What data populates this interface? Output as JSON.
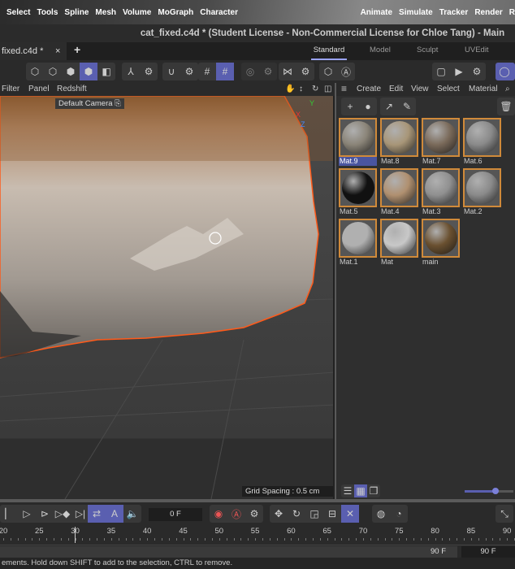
{
  "menubar": {
    "items": [
      "Select",
      "Tools",
      "Spline",
      "Mesh",
      "Volume",
      "MoGraph",
      "Character"
    ],
    "right_items": [
      "Animate",
      "Simulate",
      "Tracker",
      "Render",
      "R"
    ]
  },
  "window_title": "cat_fixed.c4d * (Student License - Non-Commercial License for Chloe Tang) - Main",
  "document_tab": {
    "label": "fixed.c4d *",
    "close": "×",
    "add": "+"
  },
  "layouts": [
    {
      "label": "Standard",
      "active": true
    },
    {
      "label": "Model"
    },
    {
      "label": "Sculpt"
    },
    {
      "label": "UVEdit"
    }
  ],
  "viewport": {
    "menu": [
      "Filter",
      "Panel",
      "Redshift"
    ],
    "camera": "Default Camera",
    "grid_spacing": "Grid Spacing : 0.5 cm",
    "axis": {
      "y": "Y",
      "x": "X",
      "z": "Z"
    }
  },
  "material_manager": {
    "menu": [
      "Create",
      "Edit",
      "View",
      "Select",
      "Material"
    ],
    "materials": [
      {
        "name": "Mat.9",
        "selected": true,
        "color": "#8a8478"
      },
      {
        "name": "Mat.8",
        "color": "#a89678"
      },
      {
        "name": "Mat.7",
        "color": "#7a6a5a"
      },
      {
        "name": "Mat.6",
        "color": "#8a8a8a"
      },
      {
        "name": "Mat.5",
        "color": "#111111"
      },
      {
        "name": "Mat.4",
        "color": "#b09070"
      },
      {
        "name": "Mat.3",
        "color": "#909090"
      },
      {
        "name": "Mat.2",
        "color": "#8a8a8a"
      },
      {
        "name": "Mat.1",
        "color": "#b0b0b0"
      },
      {
        "name": "Mat",
        "color": "#c8c8c8"
      },
      {
        "name": "main",
        "color": "#6a5030"
      }
    ]
  },
  "timeline": {
    "current_frame": "0 F",
    "end_frame": "90 F",
    "max_frame": "90 F",
    "ticks": [
      "20",
      "25",
      "30",
      "35",
      "40",
      "45",
      "50",
      "55",
      "60",
      "65",
      "70",
      "75",
      "80",
      "85",
      "90"
    ]
  },
  "status": "ements. Hold down SHIFT to add to the selection, CTRL to remove.",
  "colors": {
    "accent": "#5a5fb0",
    "selection_outline": "#ff5a1a",
    "material_border": "#d08a3a"
  }
}
